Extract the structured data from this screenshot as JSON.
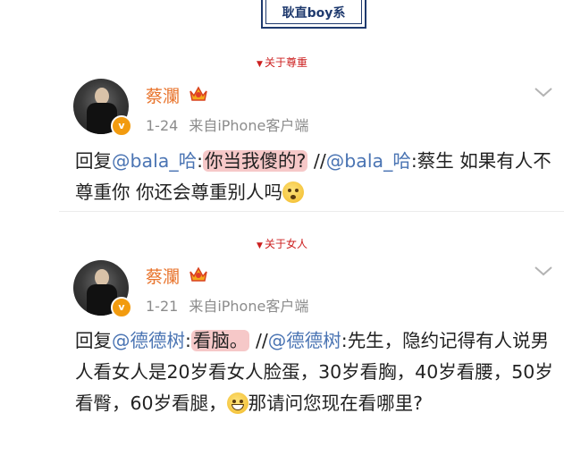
{
  "banner": {
    "title": "耿直boy系"
  },
  "posts": [
    {
      "tag": "关于尊重",
      "username": "蔡瀾",
      "verified_badge": "v",
      "date": "1-24",
      "source": "来自iPhone客户端",
      "reply_prefix": "回复",
      "mention1": "@bala_哈",
      "colon1": ":",
      "highlight": "你当我傻的?",
      "sep": " //",
      "mention2": "@bala_哈",
      "colon2": ":",
      "quoted": "蔡生 如果有人不尊重你 你还会尊重别人吗",
      "emoji": "speechless-face"
    },
    {
      "tag": "关于女人",
      "username": "蔡瀾",
      "verified_badge": "v",
      "date": "1-21",
      "source": "来自iPhone客户端",
      "reply_prefix": "回复",
      "mention1": "@德德树",
      "colon1": ":",
      "highlight": "看脑。",
      "sep": " //",
      "mention2": "@德德树",
      "colon2": ":",
      "quoted": "先生，隐约记得有人说男人看女人是20岁看女人脸蛋，30岁看胸，40岁看腰，50岁看臀，60岁看腿，",
      "emoji": "grinning-face",
      "quoted_end": "那请问您现在看哪里?"
    }
  ],
  "colors": {
    "username": "#e8732b",
    "mention": "#4a74b3",
    "highlight": "#f6c8c8",
    "tag": "#cc1f1f",
    "banner": "#1f3a6e"
  }
}
